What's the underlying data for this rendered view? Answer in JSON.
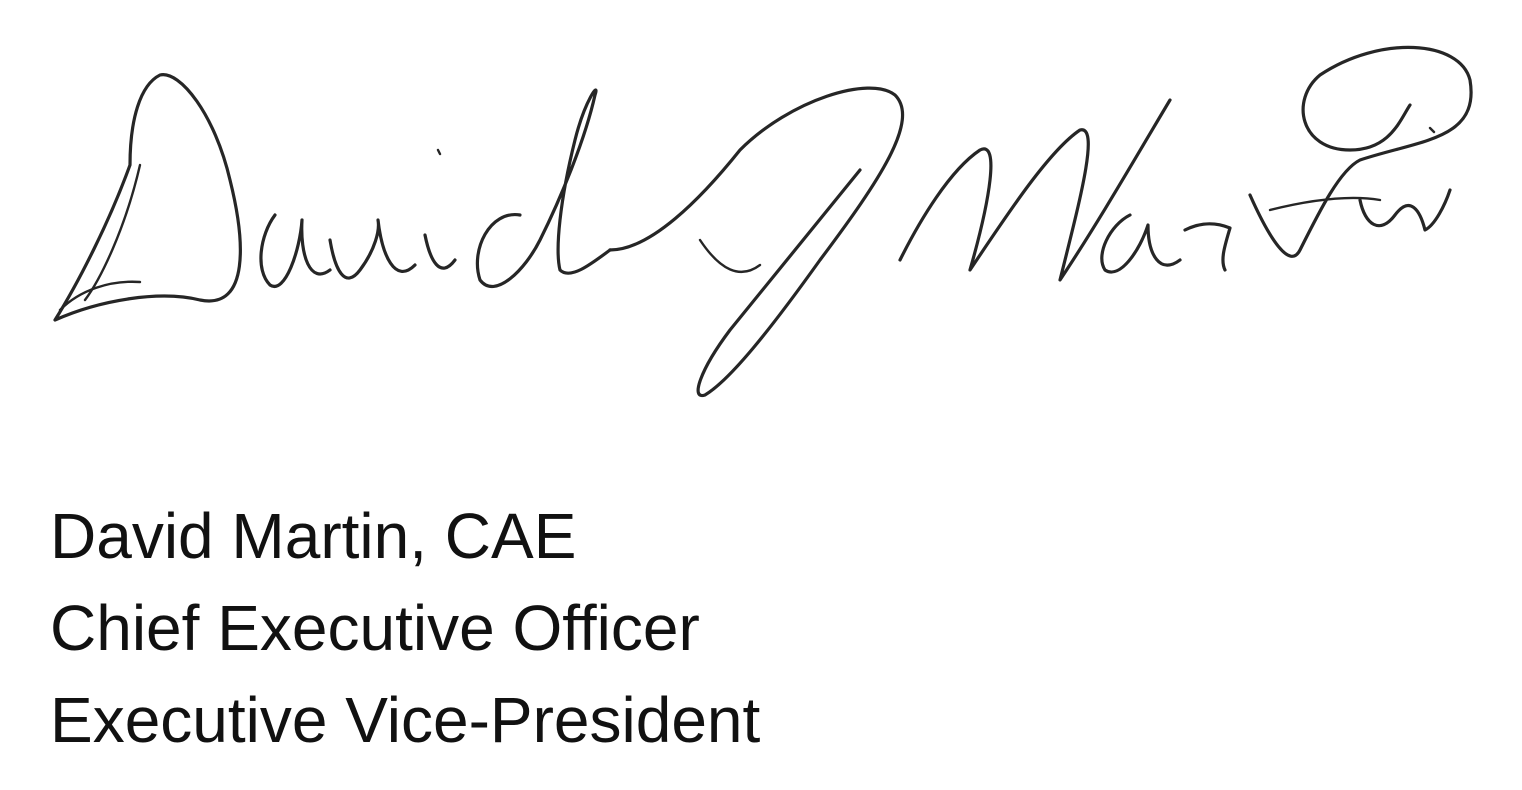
{
  "signature": {
    "signer_name": "David Martin, CAE",
    "titles": [
      "Chief Executive Officer",
      "Executive Vice-President"
    ]
  },
  "colors": {
    "ink": "#262626",
    "text": "#111111",
    "background": "#ffffff"
  }
}
